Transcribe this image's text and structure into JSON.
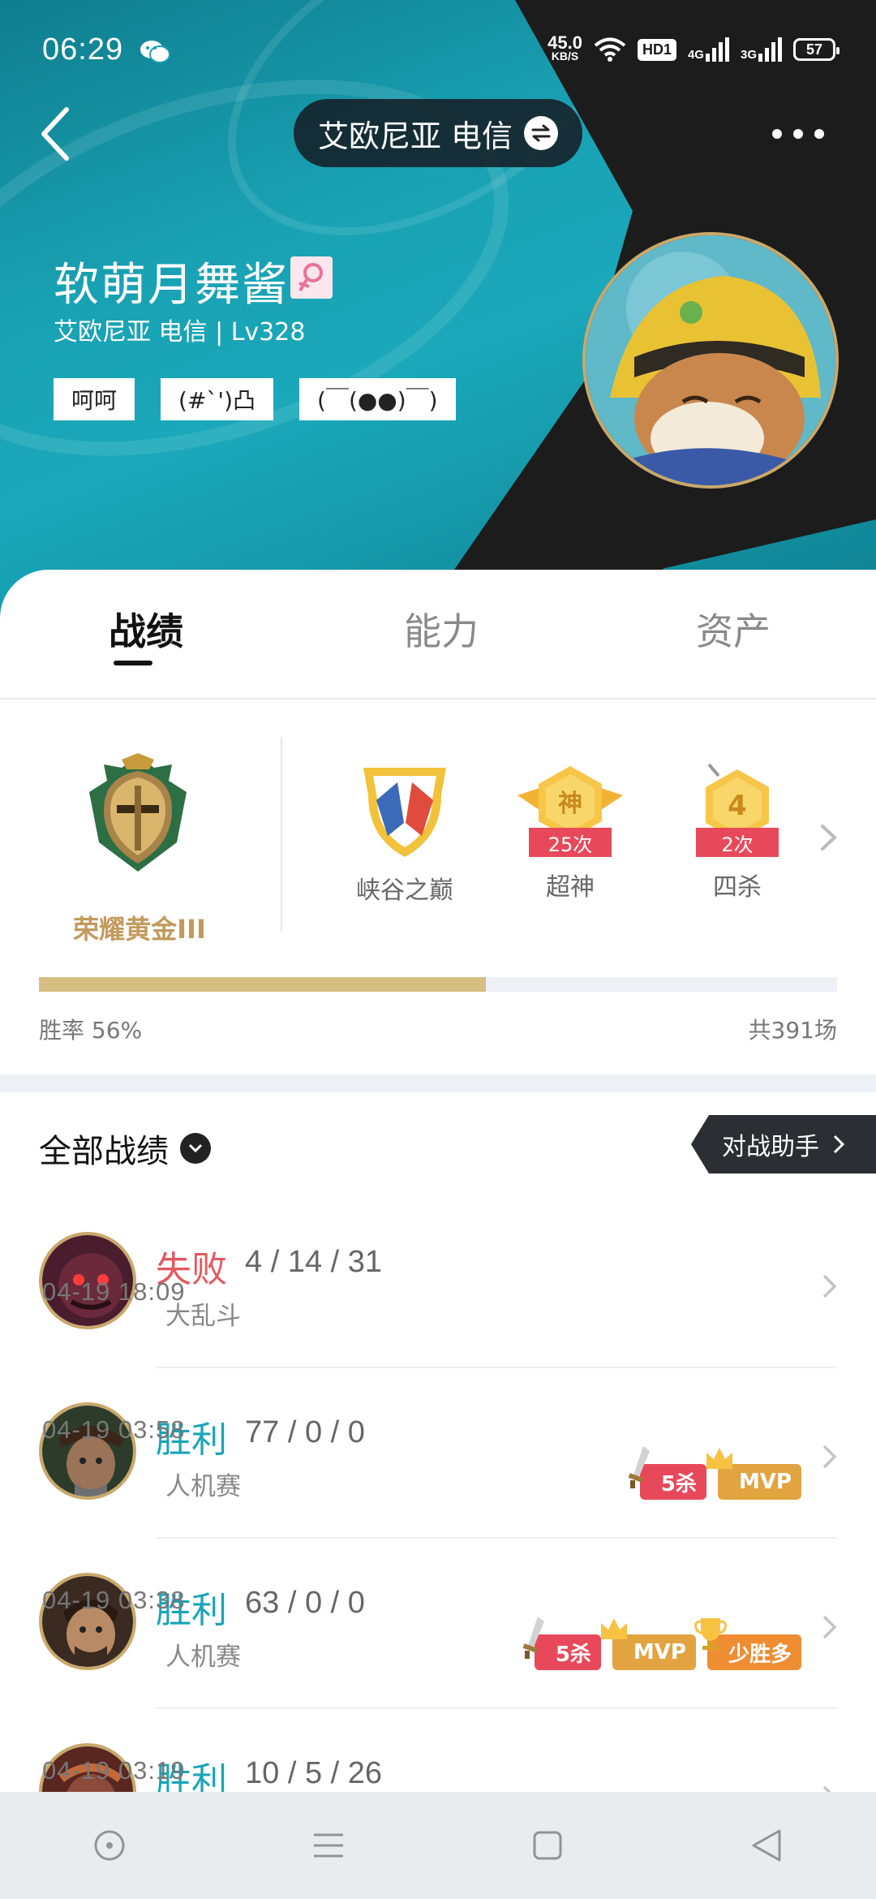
{
  "status_bar": {
    "time": "06:29",
    "net_speed_value": "45.0",
    "net_speed_unit": "KB/S",
    "hd_label": "HD1",
    "signal1_label": "4G",
    "signal2_label": "3G",
    "battery": "57"
  },
  "header": {
    "server_selector": "艾欧尼亚 电信",
    "username": "软萌月舞酱",
    "server_level": "艾欧尼亚 电信 | Lv328",
    "tags": [
      "呵呵",
      "(#`')凸",
      "(￣(●●)￣)"
    ]
  },
  "tabs": [
    {
      "label": "战绩",
      "active": true
    },
    {
      "label": "能力",
      "active": false
    },
    {
      "label": "资产",
      "active": false
    }
  ],
  "rank": {
    "tier": "荣耀黄金III",
    "honors": [
      {
        "name": "峡谷之巅",
        "count": ""
      },
      {
        "name": "超神",
        "count": "25次",
        "emblem_text": "神"
      },
      {
        "name": "四杀",
        "count": "2次",
        "emblem_text": "4"
      }
    ],
    "win_rate_label": "胜率  56%",
    "win_rate": 0.56,
    "total_games": "共391场"
  },
  "list": {
    "title": "全部战绩",
    "assistant_button": "对战助手",
    "matches": [
      {
        "result": "失败",
        "outcome": "lose",
        "kda": "4 / 14 / 31",
        "mode": "大乱斗",
        "time": "04-19 18:09",
        "badges": []
      },
      {
        "result": "胜利",
        "outcome": "win",
        "kda": "77 / 0 / 0",
        "mode": "人机赛",
        "time": "04-19 03:58",
        "badges": [
          "5杀",
          "MVP"
        ]
      },
      {
        "result": "胜利",
        "outcome": "win",
        "kda": "63 / 0 / 0",
        "mode": "人机赛",
        "time": "04-19 03:38",
        "badges": [
          "5杀",
          "MVP",
          "少胜多"
        ]
      },
      {
        "result": "胜利",
        "outcome": "win",
        "kda": "10 / 5 / 26",
        "mode": "",
        "time": "04-19 03:19",
        "badges": []
      }
    ]
  },
  "colors": {
    "banner_teal": "#1aa8ba",
    "lose": "#e6575f",
    "win": "#1aa4b8",
    "gold": "#c29a5c",
    "winbar_fill": "#d6bd82"
  },
  "icons": [
    "back-arrow-icon",
    "swap-icon",
    "more-icon",
    "female-icon",
    "chevron-right-icon",
    "dropdown-icon",
    "home-icon",
    "menu-icon",
    "recent-icon",
    "back-nav-icon",
    "wechat-icon",
    "wifi-icon"
  ]
}
